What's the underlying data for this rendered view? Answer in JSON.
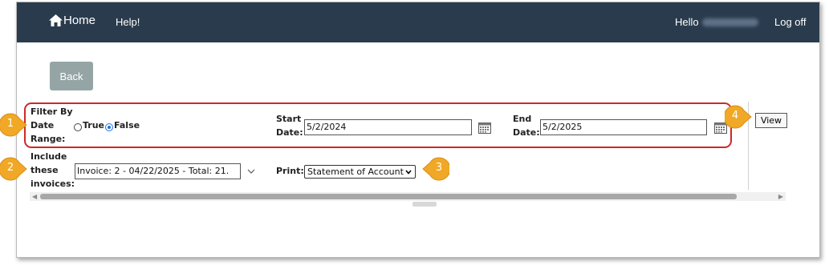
{
  "nav": {
    "home_label": "Home",
    "help_label": "Help!",
    "hello_label": "Hello",
    "logoff_label": "Log off"
  },
  "toolbar": {
    "back_label": "Back"
  },
  "filter": {
    "label_line1": "Filter By",
    "label_line2": "Date",
    "label_line3": "Range:",
    "true_label": "True",
    "false_label": "False",
    "selected": "False",
    "start_label_1": "Start",
    "start_label_2": "Date:",
    "start_value": "5/2/2024",
    "end_label_1": "End",
    "end_label_2": "Date:",
    "end_value": "5/2/2025"
  },
  "invoices": {
    "label_line1": "Include",
    "label_line2": "these",
    "label_line3": "invoices:",
    "value": "Invoice: 2 - 04/22/2025 - Total: 21."
  },
  "print": {
    "label": "Print:",
    "selected": "Statement of Account"
  },
  "view_label": "View",
  "callouts": [
    "1",
    "2",
    "3",
    "4"
  ],
  "colors": {
    "navbar": "#2a3b4d",
    "callout": "#f0a826",
    "highlight": "#cc2a2a",
    "back_button": "#95a5a6"
  }
}
